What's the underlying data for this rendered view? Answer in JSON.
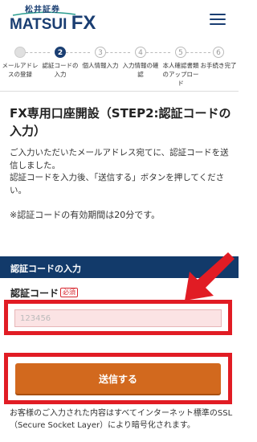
{
  "header": {
    "logo_top": "松井証券",
    "logo_main": "MATSUI",
    "logo_fx": "FX"
  },
  "steps": [
    {
      "num": "1",
      "label": "メールアドレスの登録",
      "state": "done"
    },
    {
      "num": "2",
      "label": "認証コードの入力",
      "state": "active"
    },
    {
      "num": "3",
      "label": "個人情報入力",
      "state": "todo"
    },
    {
      "num": "4",
      "label": "入力情報の確認",
      "state": "todo"
    },
    {
      "num": "5",
      "label": "本人確認書類のアップロード",
      "state": "todo"
    },
    {
      "num": "6",
      "label": "お手続き完了",
      "state": "todo"
    }
  ],
  "page": {
    "title": "FX専用口座開設（STEP2:認証コードの入力）",
    "desc_line1": "ご入力いただいたメールアドレス宛てに、認証コードを送信しました。",
    "desc_line2": "認証コードを入力後、「送信する」ボタンを押してください。",
    "notice": "※認証コードの有効期間は20分です。"
  },
  "form": {
    "section_title": "認証コードの入力",
    "field_label": "認証コード",
    "required_badge": "必須",
    "code_placeholder": "123456",
    "submit_label": "送信する"
  },
  "footer": {
    "ssl_note": "お客様のご入力された内容はすべてインターネット標準のSSL（Secure Socket Layer）により暗号化されます。"
  },
  "colors": {
    "brand_navy": "#123a6a",
    "highlight_red": "#e11c24",
    "button_orange": "#d2691e",
    "required_red": "#d7262e"
  }
}
